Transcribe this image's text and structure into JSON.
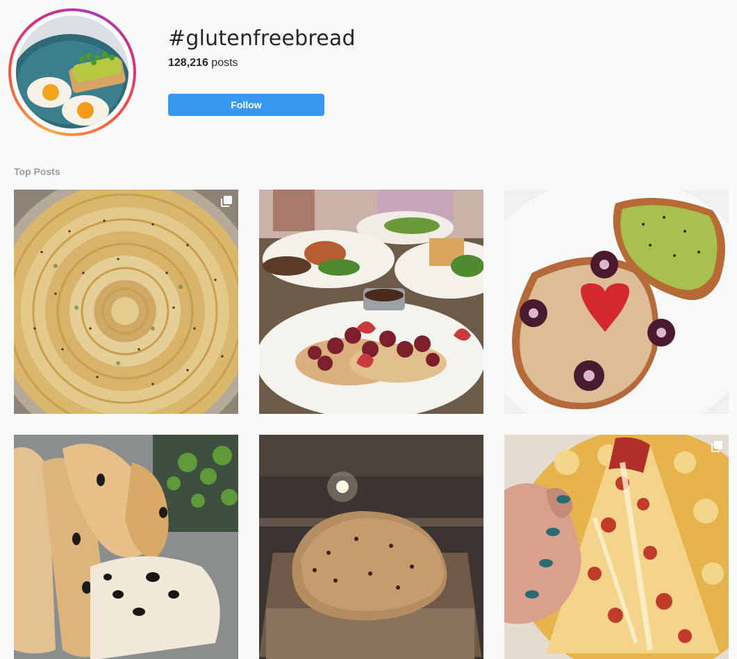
{
  "hashtag": {
    "title": "#glutenfreebread",
    "post_count": "128,216",
    "post_count_suffix": "posts",
    "follow_label": "Follow"
  },
  "sections": {
    "top_posts_label": "Top Posts"
  },
  "posts": [
    {
      "id": 1,
      "subject": "spiral-bread",
      "multi": true
    },
    {
      "id": 2,
      "subject": "brunch-pancakes",
      "multi": false
    },
    {
      "id": 3,
      "subject": "avocado-toast-strawberry-heart",
      "multi": false
    },
    {
      "id": 4,
      "subject": "olive-baguettes",
      "multi": false
    },
    {
      "id": 5,
      "subject": "bread-in-oven",
      "multi": false
    },
    {
      "id": 6,
      "subject": "cheese-pizza-slice",
      "multi": true
    }
  ],
  "colors": {
    "background": "#fafafa",
    "follow_button": "#3897f0",
    "muted_text": "#999999"
  }
}
